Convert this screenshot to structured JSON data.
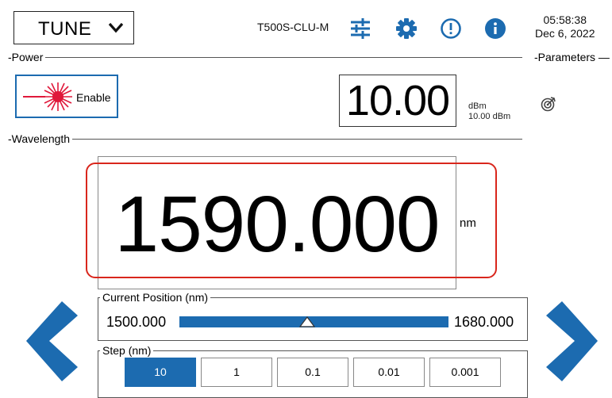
{
  "header": {
    "mode": "TUNE",
    "device": "T500S-CLU-M",
    "time": "05:58:38",
    "date": "Dec 6, 2022"
  },
  "power": {
    "section_label": "Power",
    "enable_label": "Enable",
    "value": "10.00",
    "unit": "dBm",
    "reading": "10.00 dBm"
  },
  "parameters": {
    "section_label": "Parameters"
  },
  "wavelength": {
    "section_label": "Wavelength",
    "value": "1590.000",
    "unit": "nm"
  },
  "position": {
    "label": "Current Position  (nm)",
    "min": "1500.000",
    "max": "1680.000",
    "current_fraction": 0.475
  },
  "step": {
    "label": "Step (nm)",
    "options": [
      "10",
      "1",
      "0.1",
      "0.01",
      "0.001"
    ],
    "selected": "10"
  },
  "colors": {
    "accent": "#1c6bb0",
    "highlight": "#d9261c",
    "laser": "#e0183a"
  },
  "icons": [
    "chevron-down-icon",
    "sliders-icon",
    "gear-icon",
    "alert-icon",
    "info-icon",
    "laser-icon",
    "target-icon",
    "left-arrow-icon",
    "right-arrow-icon"
  ]
}
